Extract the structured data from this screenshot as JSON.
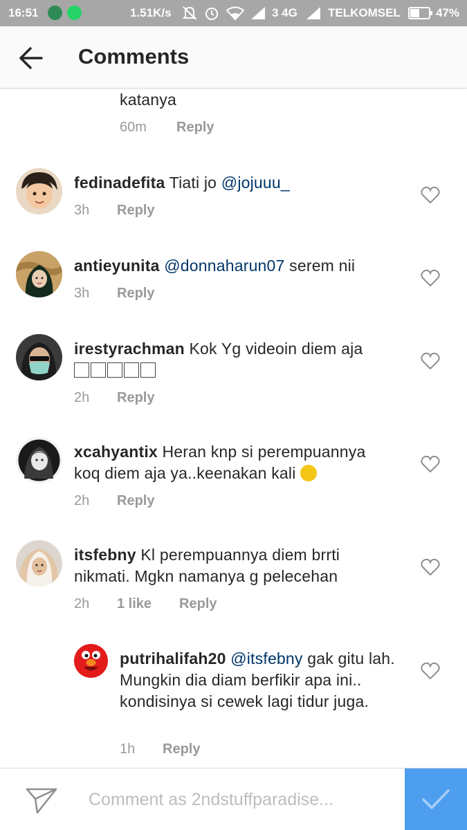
{
  "status_bar": {
    "time": "16:51",
    "net_speed": "1.51K/s",
    "network": "3 4G",
    "carrier": "TELKOMSEL",
    "battery": "47%"
  },
  "header": {
    "title": "Comments",
    "back_icon": "arrow-left-icon"
  },
  "comments": [
    {
      "text": "katanya",
      "time": "60m",
      "reply": "Reply"
    },
    {
      "username": "fedinadefita",
      "text_pre": "Tiati jo ",
      "mention": "@jojuuu_",
      "text_post": "",
      "time": "3h",
      "reply": "Reply"
    },
    {
      "username": "antieyunita",
      "text_pre": "",
      "mention": "@donnaharun07",
      "text_post": " serem nii",
      "time": "3h",
      "reply": "Reply"
    },
    {
      "username": "irestyrachman",
      "text": "Kok Yg videoin diem aja",
      "time": "2h",
      "reply": "Reply"
    },
    {
      "username": "xcahyantix",
      "text": "Heran knp si perempuannya koq diem aja ya..keenakan kali",
      "time": "2h",
      "reply": "Reply"
    },
    {
      "username": "itsfebny",
      "text": "Kl perempuannya diem brrti nikmati. Mgkn namanya g pelecehan",
      "time": "2h",
      "likes": "1 like",
      "reply": "Reply"
    },
    {
      "username": "putrihalifah20",
      "text_pre": "",
      "mention": "@itsfebny",
      "text_post": " gak gitu lah. Mungkin dia diam berfikir apa ini.. kondisinya si cewek lagi tidur juga.",
      "time": "1h",
      "reply": "Reply"
    }
  ],
  "composer": {
    "placeholder": "Comment as 2ndstuffparadise..."
  },
  "colors": {
    "mention": "#003569",
    "post_button": "#4e9eef",
    "status_bar": "#a7a7a7"
  }
}
